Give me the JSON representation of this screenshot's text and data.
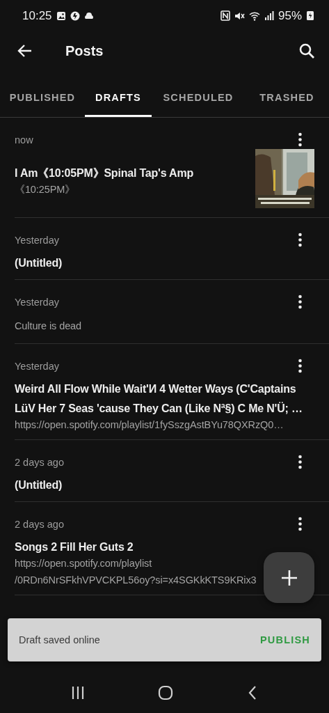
{
  "status_bar": {
    "time": "10:25",
    "battery": "95%"
  },
  "app_bar": {
    "title": "Posts"
  },
  "tabs": [
    {
      "label": "PUBLISHED",
      "selected": false
    },
    {
      "label": "DRAFTS",
      "selected": true
    },
    {
      "label": "SCHEDULED",
      "selected": false
    },
    {
      "label": "TRASHED",
      "selected": false
    }
  ],
  "posts": [
    {
      "date": "now",
      "title": "I Am《10:05PM》Spinal Tap's Amp",
      "excerpt": "《10:25PM》"
    },
    {
      "date": "Yesterday",
      "title": "(Untitled)"
    },
    {
      "date": "Yesterday",
      "excerpt": "Culture is dead"
    },
    {
      "date": "Yesterday",
      "title": "Weird All Flow While Wait'И 4 Wetter Ways (C'Captains\nLüV Her 7 Seas 'cause They Can (Like Nª§) C Me N'Ü; …",
      "excerpt": "https://open.spotify.com/playlist/1fySszgAstBYu78QXRzQ0…"
    },
    {
      "date": "2 days ago",
      "title": "(Untitled)"
    },
    {
      "date": "2 days ago",
      "title": "Songs 2 Fill Her Guts 2",
      "excerpt": "https://open.spotify.com/playlist\n/0RDn6NrSFkhVPVCKPL56oy?si=x4SGKkKTS9KRix3"
    }
  ],
  "snackbar": {
    "message": "Draft saved online",
    "action": "PUBLISH"
  }
}
